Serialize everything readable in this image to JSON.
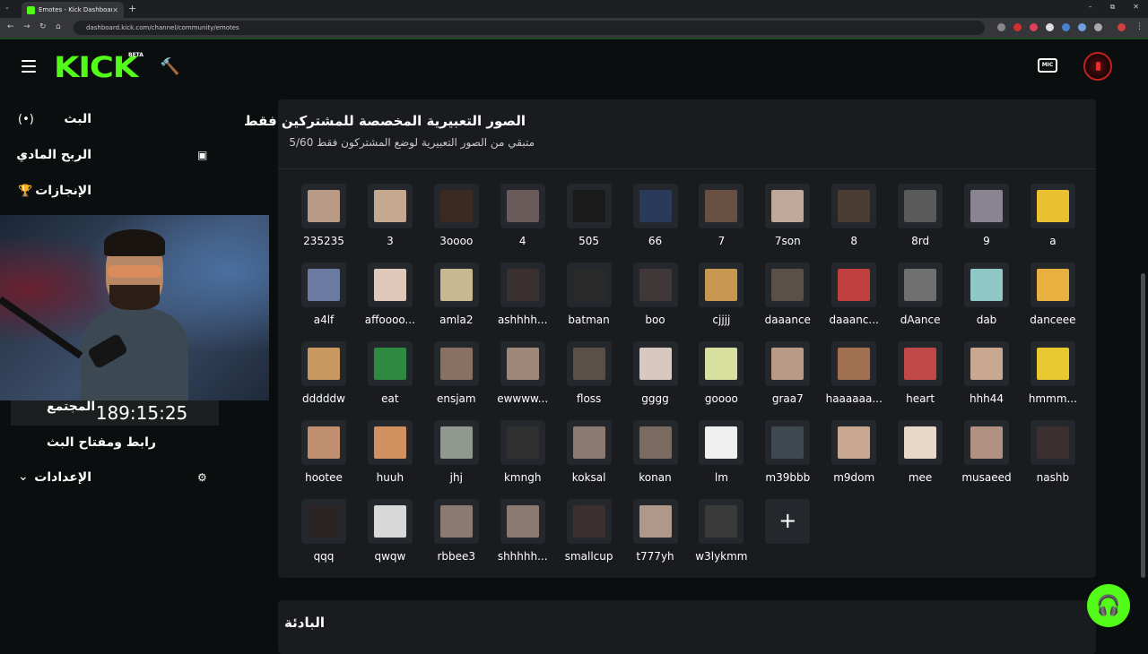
{
  "browser": {
    "tab_title": "Emotes - Kick Dashboard",
    "url": "dashboard.kick.com/channel/community/emotes",
    "new_tab": "+",
    "window_controls": [
      "–",
      "⧉",
      "✕"
    ]
  },
  "header": {
    "logo": "KICK",
    "beta": "BETA",
    "mic_icon_label": "MIC"
  },
  "sidebar": {
    "items": [
      {
        "label": "البث",
        "icon": "broadcast-icon"
      },
      {
        "label": "الربح المادي",
        "icon": "chart-icon"
      },
      {
        "label": "الإنجازات",
        "icon": "trophy-icon"
      },
      {
        "label": "الإعدادات",
        "icon": "gear-icon"
      }
    ],
    "community": "المجتمع",
    "stream_key": "رابط ومفتاح البث",
    "timer": "189:15:25"
  },
  "panel": {
    "title": "الصور التعبيرية المخصصة للمشتركين فقط",
    "subtitle": "متبقي من الصور التعبيرية لوضع المشتركون فقط 5/60",
    "add_label": "+"
  },
  "emotes": [
    {
      "name": "235235",
      "color": "#b89a86"
    },
    {
      "name": "3",
      "color": "#c4a890"
    },
    {
      "name": "3oooo",
      "color": "#3a2a20"
    },
    {
      "name": "4",
      "color": "#6a5a5a"
    },
    {
      "name": "505",
      "color": "#1a1a1a"
    },
    {
      "name": "66",
      "color": "#2a3a5a"
    },
    {
      "name": "7",
      "color": "#6a5040"
    },
    {
      "name": "7son",
      "color": "#c0a898"
    },
    {
      "name": "8",
      "color": "#4a3c30"
    },
    {
      "name": "8rd",
      "color": "#5a5a5a"
    },
    {
      "name": "9",
      "color": "#8a8490"
    },
    {
      "name": "a",
      "color": "#e8c030"
    },
    {
      "name": "a4lf",
      "color": "#6a7aa0"
    },
    {
      "name": "affoooo...",
      "color": "#e0c8b8"
    },
    {
      "name": "amla2",
      "color": "#c8b890"
    },
    {
      "name": "ashhhh...",
      "color": "#3a3030"
    },
    {
      "name": "batman",
      "color": "#2a2a2a"
    },
    {
      "name": "boo",
      "color": "#403838"
    },
    {
      "name": "cjjjj",
      "color": "#c89850"
    },
    {
      "name": "daaance",
      "color": "#5a5048"
    },
    {
      "name": "daaanc...",
      "color": "#c04040"
    },
    {
      "name": "dAance",
      "color": "#707070"
    },
    {
      "name": "dab",
      "color": "#90c8c8"
    },
    {
      "name": "danceee",
      "color": "#e8b040"
    },
    {
      "name": "dddddw",
      "color": "#c89860"
    },
    {
      "name": "eat",
      "color": "#2e8a40"
    },
    {
      "name": "ensjam",
      "color": "#8a7060"
    },
    {
      "name": "ewwww...",
      "color": "#a08878"
    },
    {
      "name": "floss",
      "color": "#5a5048"
    },
    {
      "name": "gggg",
      "color": "#d8c8c0"
    },
    {
      "name": "goooo",
      "color": "#d8e0a0"
    },
    {
      "name": "graa7",
      "color": "#b89a86"
    },
    {
      "name": "haaaaaa...",
      "color": "#a07050"
    },
    {
      "name": "heart",
      "color": "#c04848"
    },
    {
      "name": "hhh44",
      "color": "#c8a890"
    },
    {
      "name": "hmmm...",
      "color": "#e8c830"
    },
    {
      "name": "hootee",
      "color": "#c09070"
    },
    {
      "name": "huuh",
      "color": "#d09060"
    },
    {
      "name": "jhj",
      "color": "#909890"
    },
    {
      "name": "kmngh",
      "color": "#303030"
    },
    {
      "name": "koksal",
      "color": "#8a7a70"
    },
    {
      "name": "konan",
      "color": "#7a6a60"
    },
    {
      "name": "lm",
      "color": "#f0f0f0"
    },
    {
      "name": "m39bbb",
      "color": "#404850"
    },
    {
      "name": "m9dom",
      "color": "#c8a890"
    },
    {
      "name": "mee",
      "color": "#e8d8c8"
    },
    {
      "name": "musaeed",
      "color": "#b09080"
    },
    {
      "name": "nashb",
      "color": "#3a3030"
    },
    {
      "name": "qqq",
      "color": "#2a2424"
    },
    {
      "name": "qwqw",
      "color": "#d8d8d8"
    },
    {
      "name": "rbbee3",
      "color": "#8a7a70"
    },
    {
      "name": "shhhhh...",
      "color": "#8a7a70"
    },
    {
      "name": "smallcup",
      "color": "#3a3030"
    },
    {
      "name": "t777yh",
      "color": "#b09888"
    },
    {
      "name": "w3lykmm",
      "color": "#3a3a3a"
    }
  ],
  "section2": {
    "title": "البادئة"
  },
  "colors": {
    "accent": "#53fc18",
    "panel_bg": "#191b1f",
    "page_bg": "#0b0e0f"
  }
}
